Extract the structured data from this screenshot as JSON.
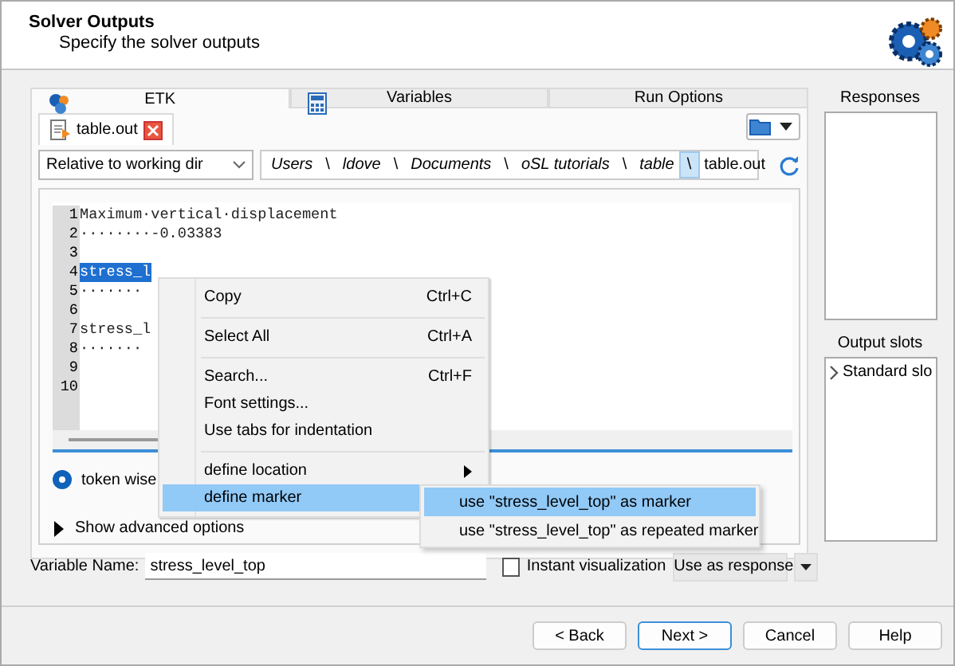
{
  "header": {
    "title": "Solver Outputs",
    "subtitle": "Specify the solver outputs"
  },
  "tabs": [
    {
      "label": "ETK",
      "selected": true
    },
    {
      "label": "Variables",
      "selected": false
    },
    {
      "label": "Run Options",
      "selected": false
    }
  ],
  "file_tab": {
    "label": "table.out"
  },
  "path_mode": "Relative to working dir",
  "breadcrumb": [
    {
      "label": "Users",
      "separator": "\\",
      "hovered": false
    },
    {
      "label": "ldove",
      "separator": "\\",
      "hovered": false
    },
    {
      "label": "Documents",
      "separator": "\\",
      "hovered": false
    },
    {
      "label": "oSL tutorials",
      "separator": "\\",
      "hovered": false
    },
    {
      "label": "table",
      "separator": "\\",
      "hovered": true
    },
    {
      "label": "table.out"
    }
  ],
  "editor": {
    "lines": [
      {
        "number": "1",
        "text": "Maximum·vertical·displacement",
        "selected": false
      },
      {
        "number": "2",
        "text": "········-0.03383",
        "selected": false
      },
      {
        "number": "3"
      },
      {
        "number": "4",
        "text": "stress_l",
        "selected": true
      },
      {
        "number": "5",
        "text": "·······",
        "selected": false
      },
      {
        "number": "6"
      },
      {
        "number": "7",
        "text": "stress_l",
        "selected": false
      },
      {
        "number": "8",
        "text": "·······",
        "selected": false
      },
      {
        "number": "9"
      },
      {
        "number": "10"
      }
    ]
  },
  "mode_radio": {
    "label": "token wise",
    "selected": true
  },
  "advanced": {
    "label": "Show advanced options",
    "expanded": false
  },
  "variable_name": {
    "label": "Variable Name:",
    "value": "stress_level_top"
  },
  "instant_visualization": {
    "label": "Instant visualization",
    "checked": false
  },
  "response_button": "Use as response",
  "responses": {
    "title": "Responses"
  },
  "output_slots": {
    "title": "Output slots",
    "items": [
      {
        "label": "Standard slo",
        "expanded": false
      }
    ]
  },
  "buttons": [
    {
      "label": "< Back",
      "default": false
    },
    {
      "label": "Next >",
      "default": true
    },
    {
      "label": "Cancel",
      "default": false
    },
    {
      "label": "Help",
      "default": false
    }
  ],
  "context_menu": {
    "items": [
      {
        "kind": "item",
        "label": "Copy",
        "shortcut": "Ctrl+C"
      },
      {
        "kind": "separator"
      },
      {
        "kind": "item",
        "label": "Select All",
        "shortcut": "Ctrl+A"
      },
      {
        "kind": "separator"
      },
      {
        "kind": "item",
        "label": "Search...",
        "shortcut": "Ctrl+F"
      },
      {
        "kind": "item",
        "label": "Font settings..."
      },
      {
        "kind": "item",
        "label": "Use tabs for indentation"
      },
      {
        "kind": "separator"
      },
      {
        "kind": "submenu",
        "label": "define location",
        "selected": false
      },
      {
        "kind": "submenu",
        "label": "define marker",
        "selected": true
      }
    ]
  },
  "submenu": {
    "items": [
      {
        "label": "use \"stress_level_top\" as marker",
        "selected": true
      },
      {
        "label": "use \"stress_level_top\" as repeated marker",
        "selected": false
      }
    ]
  }
}
